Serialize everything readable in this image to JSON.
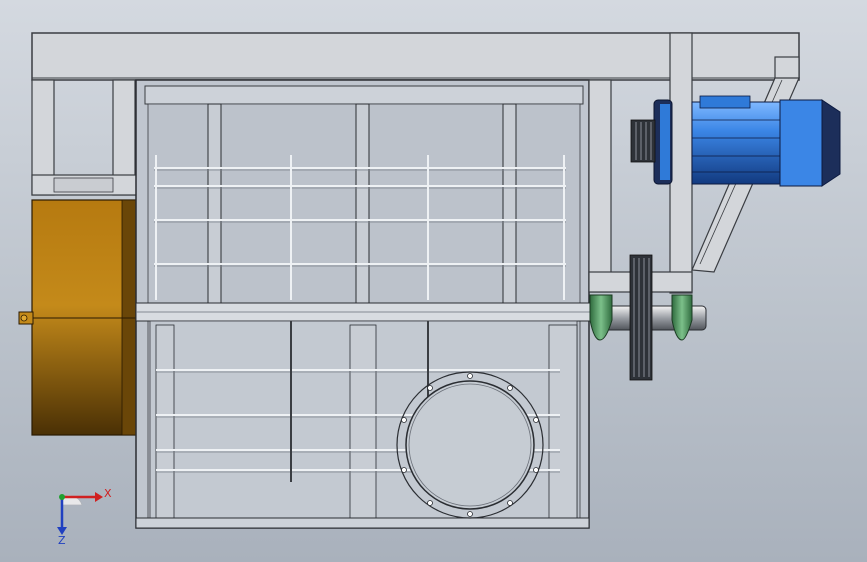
{
  "colors": {
    "frame_fill": "#d3d6da",
    "frame_stroke": "#3a3d42",
    "tank_fill": "#c0c6cf",
    "tank_inner": "#b8bec8",
    "rod": "#eef1f4",
    "rod_shadow": "#6a6f78",
    "bronze_light": "#c48a1a",
    "bronze_dark": "#5a3a06",
    "motor_blue": "#2f7ad8",
    "motor_blue_light": "#5ea7ff",
    "motor_dark": "#1c2e5a",
    "bearing_green": "#4c8a5a",
    "pulley_dark": "#2e3238",
    "axis_x": "#d02020",
    "axis_y": "#20a030",
    "axis_z": "#2040c0"
  },
  "icons": {
    "triad": "coordinate-triad-icon"
  },
  "triad": {
    "x_label": "X",
    "z_label": "Z"
  }
}
